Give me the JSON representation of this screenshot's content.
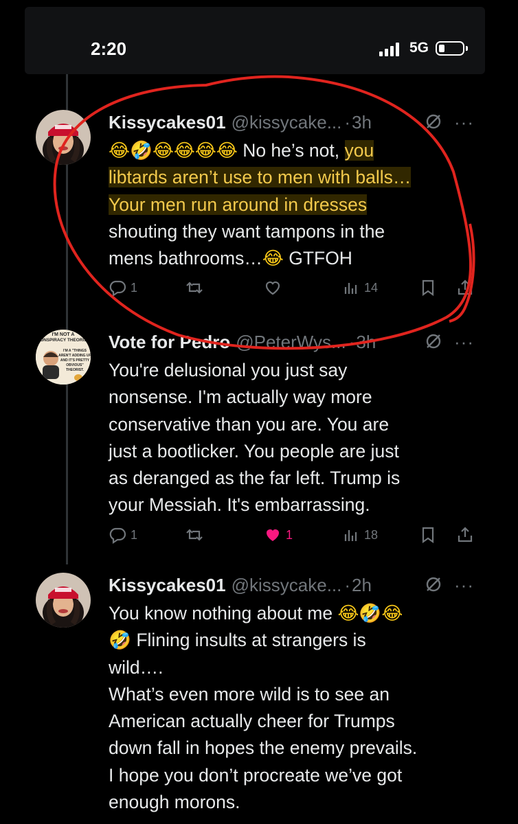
{
  "status_bar": {
    "time": "2:20",
    "network": "5G"
  },
  "tweets": [
    {
      "name": "Kissycakes01",
      "handle": "@kissycake...",
      "time": "3h",
      "lines": [
        {
          "emoji": "😂🤣😂😂😂😂",
          "plain": " No he’s not, ",
          "highlight": "you"
        },
        {
          "highlight": "libtards aren’t use to men with balls…"
        },
        {
          "highlight": "Your men run around in dresses"
        },
        {
          "plain": "shouting they want tampons in the"
        },
        {
          "plain": "mens bathrooms…",
          "emoji": "😂",
          "plain2": " GTFOH"
        }
      ],
      "stats": {
        "replies": "1",
        "reposts": "",
        "likes": "",
        "views": "14"
      }
    },
    {
      "name": "Vote for Pedro",
      "handle": "@PeterWys...",
      "time": "3h",
      "avatar_text": {
        "top": "I'M NOT A",
        "top2": "CONSPIRACY THEORIST",
        "mid": "I'M A \"THINGS AREN'T ADDING UP AND IT'S PRETTY OBVIOUS\" THEORIST."
      },
      "lines": [
        "You're delusional you just say",
        "nonsense.  I'm actually way more",
        "conservative than you are.  You are",
        "just a bootlicker.  You people are just",
        "as deranged as the far left.  Trump is",
        "your Messiah.  It's embarrassing."
      ],
      "stats": {
        "replies": "1",
        "reposts": "",
        "likes": "1",
        "views": "18"
      }
    },
    {
      "name": "Kissycakes01",
      "handle": "@kissycake...",
      "time": "2h",
      "lines": [
        {
          "plain": "You know nothing about me ",
          "emoji": "😂🤣😂"
        },
        {
          "emoji": "🤣",
          "plain": " Flining insults at strangers is"
        },
        {
          "plain": "wild…."
        },
        {
          "plain": "What’s even more wild is to see an"
        },
        {
          "plain": "American actually cheer for Trumps"
        },
        {
          "plain": "down fall in hopes the enemy prevails."
        },
        {
          "plain": "I hope you don’t procreate we’ve got"
        },
        {
          "plain": "enough morons."
        }
      ]
    }
  ],
  "colors": {
    "background": "#000000",
    "text": "#e7e9ea",
    "muted": "#71767b",
    "like": "#f91880",
    "highlight": "#f2c94c",
    "annotation": "#e0241e"
  }
}
